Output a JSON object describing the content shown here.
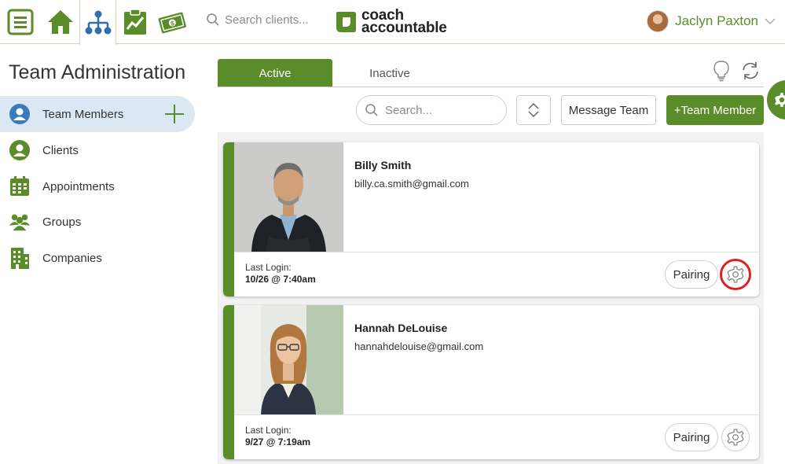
{
  "topbar": {
    "search_placeholder": "Search clients...",
    "logo_line1": "coach",
    "logo_line2": "accountable",
    "user_name": "Jaclyn Paxton",
    "icons": [
      "menu-icon",
      "home-icon",
      "org-chart-icon",
      "clipboard-chart-icon",
      "money-icon",
      "search-icon",
      "chevron-down-icon"
    ]
  },
  "sidebar": {
    "title": "Team Administration",
    "items": [
      {
        "label": "Team Members",
        "icon": "person-icon",
        "active": true
      },
      {
        "label": "Clients",
        "icon": "person-icon"
      },
      {
        "label": "Appointments",
        "icon": "calendar-icon"
      },
      {
        "label": "Groups",
        "icon": "group-icon"
      },
      {
        "label": "Companies",
        "icon": "building-icon"
      }
    ]
  },
  "tabs": {
    "active": "Active",
    "inactive": "Inactive"
  },
  "toolbar": {
    "search_placeholder": "Search...",
    "message_label": "Message Team",
    "add_label": "+Team Member"
  },
  "members": [
    {
      "name": "Billy Smith",
      "email": "billy.ca.smith@gmail.com",
      "last_login_label": "Last Login:",
      "last_login": "10/26 @ 7:40am",
      "pairing_label": "Pairing"
    },
    {
      "name": "Hannah DeLouise",
      "email": "hannahdelouise@gmail.com",
      "last_login_label": "Last Login:",
      "last_login": "9/27 @ 7:19am",
      "pairing_label": "Pairing"
    }
  ],
  "colors": {
    "brand_green": "#5b8c2a",
    "active_nav": "#dbe8f3",
    "highlight_red": "#e02020"
  }
}
